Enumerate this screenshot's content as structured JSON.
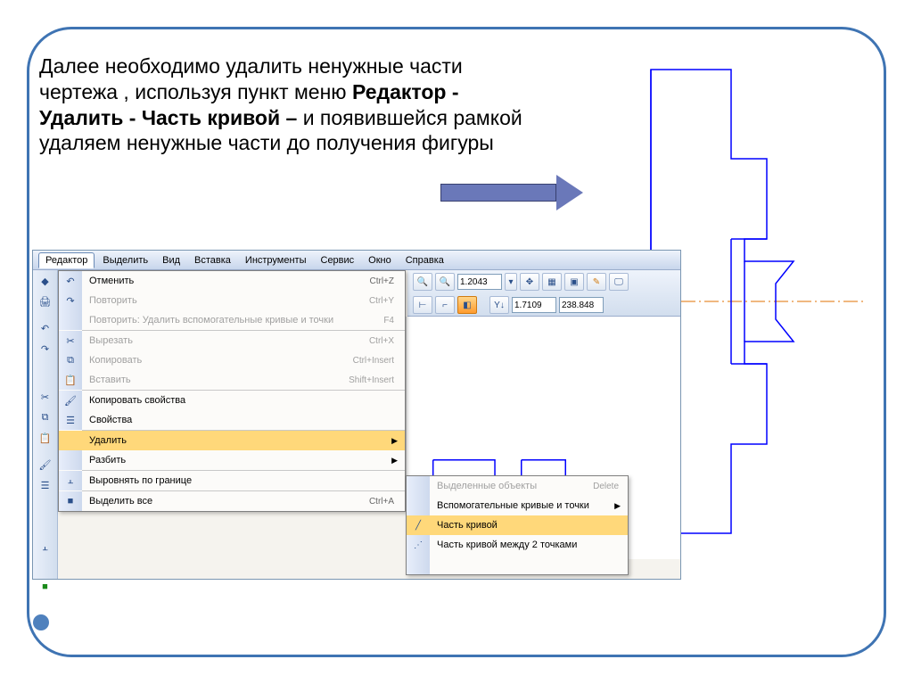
{
  "instruction": {
    "part1": "Далее необходимо удалить ненужные части чертежа , используя пункт меню ",
    "bold1": "Редактор - Удалить  - Часть кривой – ",
    "part2": "и появившейся рамкой удаляем ненужные части до получения  фигуры"
  },
  "menubar": [
    "Редактор",
    "Выделить",
    "Вид",
    "Вставка",
    "Инструменты",
    "Сервис",
    "Окно",
    "Справка"
  ],
  "right_tools": {
    "zoom_value": "1.2043",
    "y_label": "Y↓",
    "coord_x": "1.7109",
    "coord_y": "238.848"
  },
  "dropdown": [
    {
      "icon": "↶",
      "label": "Отменить",
      "shortcut": "Ctrl+Z",
      "disabled": false
    },
    {
      "icon": "↷",
      "label": "Повторить",
      "shortcut": "Ctrl+Y",
      "disabled": true
    },
    {
      "icon": "",
      "label": "Повторить: Удалить вспомогательные кривые и точки",
      "shortcut": "F4",
      "disabled": true
    },
    {
      "sep": true
    },
    {
      "icon": "✂",
      "label": "Вырезать",
      "shortcut": "Ctrl+X",
      "disabled": true
    },
    {
      "icon": "⧉",
      "label": "Копировать",
      "shortcut": "Ctrl+Insert",
      "disabled": true
    },
    {
      "icon": "📋",
      "label": "Вставить",
      "shortcut": "Shift+Insert",
      "disabled": true
    },
    {
      "sep": true
    },
    {
      "icon": "🖌",
      "label": "Копировать свойства",
      "shortcut": "",
      "disabled": false
    },
    {
      "icon": "☰",
      "label": "Свойства",
      "shortcut": "",
      "disabled": false
    },
    {
      "sep": true
    },
    {
      "icon": "",
      "label": "Удалить",
      "shortcut": "",
      "arrow": true,
      "highlight": true
    },
    {
      "icon": "",
      "label": "Разбить",
      "shortcut": "",
      "arrow": true,
      "disabled": false
    },
    {
      "sep": true
    },
    {
      "icon": "⫠",
      "label": "Выровнять по границе",
      "shortcut": "",
      "disabled": false
    },
    {
      "sep": true
    },
    {
      "icon": "■",
      "label": "Выделить все",
      "shortcut": "Ctrl+A",
      "disabled": false
    }
  ],
  "submenu": [
    {
      "icon": "",
      "label": "Выделенные объекты",
      "shortcut": "Delete",
      "disabled": true
    },
    {
      "icon": "",
      "label": "Вспомогательные кривые и точки",
      "arrow": true,
      "disabled": false
    },
    {
      "icon": "╱",
      "label": "Часть кривой",
      "highlight": true
    },
    {
      "icon": "⋰",
      "label": "Часть кривой между 2 точками",
      "disabled": false
    },
    {
      "icon": "",
      "label": "",
      "disabled": false
    }
  ],
  "sidebar_icons": [
    "◆",
    "🖨",
    "↶",
    "↷",
    "✂",
    "⧉",
    "📋",
    "🖌",
    "☰",
    "",
    "",
    "⫠",
    "",
    "■"
  ]
}
